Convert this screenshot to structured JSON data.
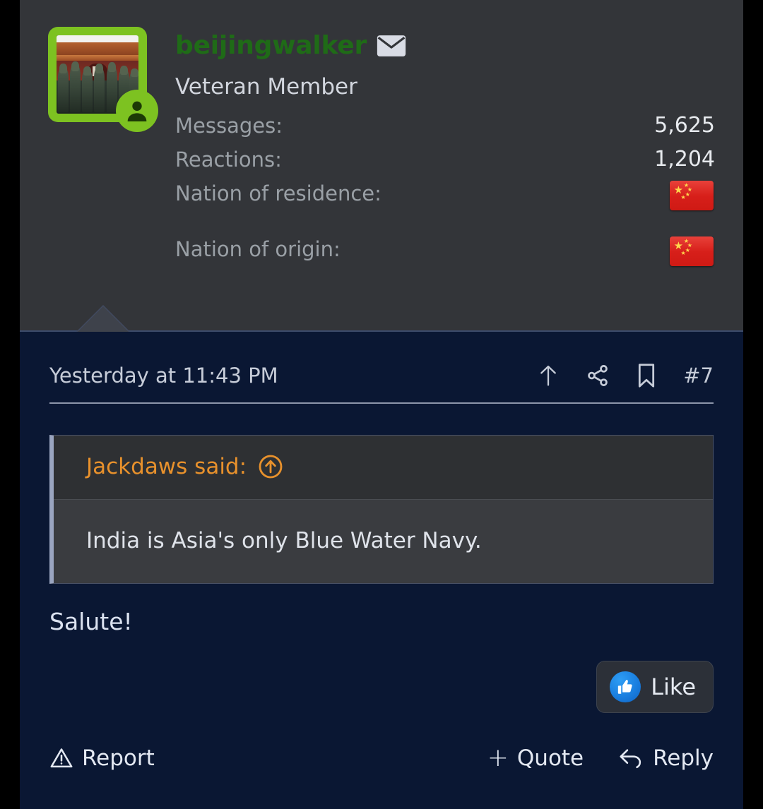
{
  "theme": {
    "page_background": "#000000",
    "header_background": "#333539",
    "post_background": "#0a1733",
    "username_color": "#1f6b17",
    "quote_author_color": "#e8912c",
    "avatar_border_color": "#7dc221",
    "like_icon_color": "#1a7fe0",
    "flag_color": "#d71f1a"
  },
  "user": {
    "username": "beijingwalker",
    "mail_icon": "envelope-icon",
    "title": "Veteran Member",
    "avatar_alt": "military parade avatar",
    "online_badge_icon": "user-circle-icon",
    "stats": [
      {
        "label": "Messages:",
        "value": "5,625",
        "type": "text"
      },
      {
        "label": "Reactions:",
        "value": "1,204",
        "type": "text"
      },
      {
        "label": "Nation of residence:",
        "value": "china-flag",
        "type": "flag"
      },
      {
        "label": "Nation of origin:",
        "value": "china-flag",
        "type": "flag"
      }
    ]
  },
  "post": {
    "date": "Yesterday at 11:43 PM",
    "number": "#7",
    "header_icons": [
      {
        "name": "up-arrow-icon"
      },
      {
        "name": "share-icon"
      },
      {
        "name": "bookmark-icon"
      }
    ],
    "quote": {
      "author_line": "Jackdaws said:",
      "jump_icon": "circled-up-arrow-icon",
      "text": "India is Asia's only Blue Water Navy."
    },
    "message": "Salute!",
    "reaction": {
      "label": "Like",
      "icon": "thumbs-up-icon"
    },
    "actions": {
      "report": {
        "label": "Report",
        "icon": "warning-triangle-icon"
      },
      "quote": {
        "label": "Quote",
        "icon": "plus-icon",
        "plus": "+"
      },
      "reply": {
        "label": "Reply",
        "icon": "reply-arrow-icon"
      }
    }
  }
}
